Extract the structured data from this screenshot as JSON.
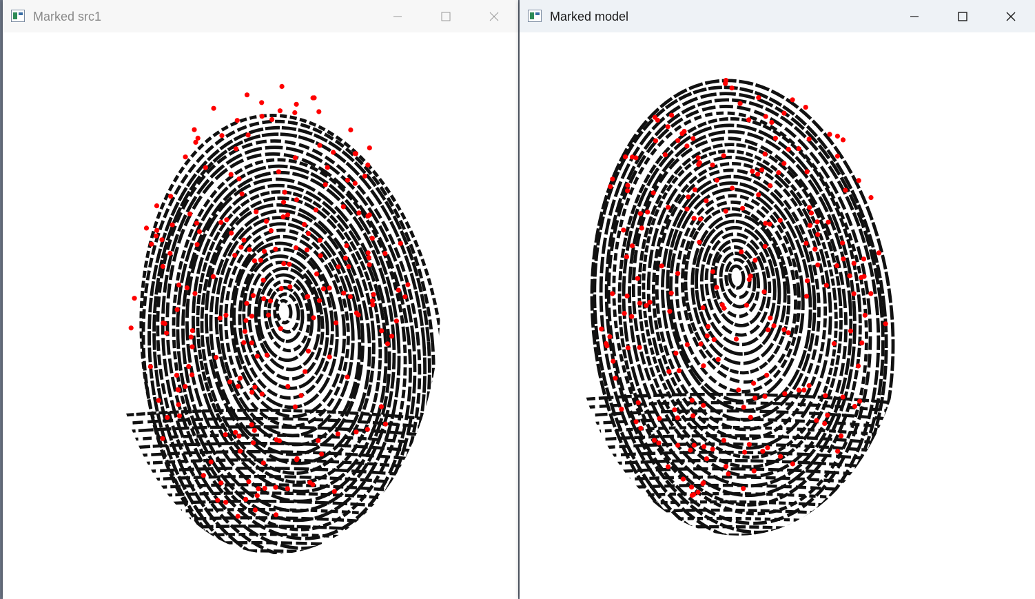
{
  "windows": [
    {
      "id": "left",
      "title": "Marked src1",
      "controls": [
        "minimize-icon",
        "maximize-icon",
        "close-icon"
      ],
      "image": "fingerprint with red marked minutiae points"
    },
    {
      "id": "right",
      "title": "Marked model",
      "controls": [
        "minimize-icon",
        "maximize-icon",
        "close-icon"
      ],
      "image": "fingerprint with red marked minutiae points"
    }
  ],
  "colors": {
    "ridge": "#111111",
    "marker": "#ff0000",
    "background": "#ffffff",
    "titlebar_left": "#f7f7f7",
    "titlebar_right": "#eef2f6"
  }
}
